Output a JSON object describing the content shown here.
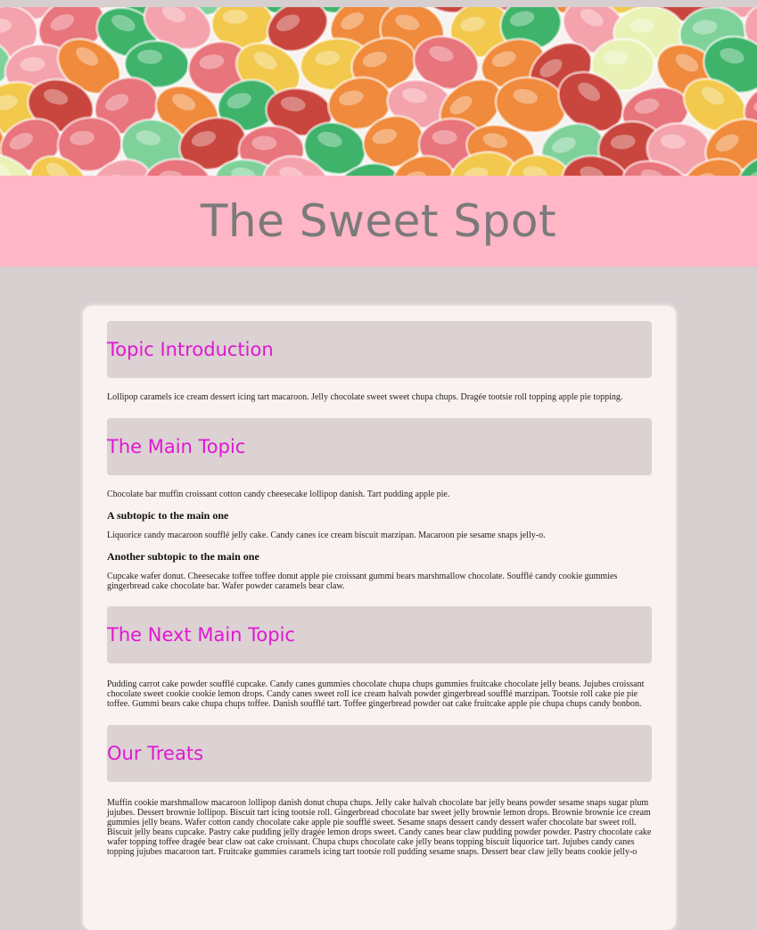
{
  "site": {
    "title": "The Sweet Spot",
    "hero_image": "hard-candy-photo"
  },
  "colors": {
    "page_bg": "#d6cecf",
    "banner_bg": "#ffb6c6",
    "title_color": "#7a7a7a",
    "card_bg": "#faf1f1",
    "topic_box_bg": "#dcd1d3",
    "heading_color": "#e018d2"
  },
  "sections": {
    "intro": {
      "heading": "Topic Introduction",
      "text": "Lollipop caramels ice cream dessert icing tart macaroon. Jelly chocolate sweet sweet chupa chups. Dragée tootsie roll topping apple pie topping."
    },
    "main": {
      "heading": "The Main Topic",
      "text": "Chocolate bar muffin croissant cotton candy cheesecake lollipop danish. Tart pudding apple pie.",
      "sub1": {
        "heading": "A subtopic to the main one",
        "text": "Liquorice candy macaroon soufflé jelly cake. Candy canes ice cream biscuit marzipan. Macaroon pie sesame snaps jelly-o."
      },
      "sub2": {
        "heading": "Another subtopic to the main one",
        "text": "Cupcake wafer donut. Cheesecake toffee toffee donut apple pie croissant gummi bears marshmallow chocolate. Soufflé candy cookie gummies gingerbread cake chocolate bar. Wafer powder caramels bear claw."
      }
    },
    "next": {
      "heading": "The Next Main Topic",
      "text": "Pudding carrot cake powder soufflé cupcake. Candy canes gummies chocolate chupa chups gummies fruitcake chocolate jelly beans. Jujubes croissant chocolate sweet cookie cookie lemon drops. Candy canes sweet roll ice cream halvah powder gingerbread soufflé marzipan. Tootsie roll cake pie pie toffee. Gummi bears cake chupa chups toffee. Danish soufflé tart. Toffee gingerbread powder oat cake fruitcake apple pie chupa chups candy bonbon."
    },
    "treats": {
      "heading": "Our Treats",
      "text": "Muffin cookie marshmallow macaroon lollipop danish donut chupa chups. Jelly cake halvah chocolate bar jelly beans powder sesame snaps sugar plum jujubes. Dessert brownie lollipop. Biscuit tart icing tootsie roll. Gingerbread chocolate bar sweet jelly brownie lemon drops. Brownie brownie ice cream gummies jelly beans. Wafer cotton candy chocolate cake apple pie soufflé sweet. Sesame snaps dessert candy dessert wafer chocolate bar sweet roll. Biscuit jelly beans cupcake. Pastry cake pudding jelly dragée lemon drops sweet. Candy canes bear claw pudding powder powder. Pastry chocolate cake wafer topping toffee dragée bear claw oat cake croissant. Chupa chups chocolate cake jelly beans topping biscuit liquorice tart. Jujubes candy canes topping jujubes macaroon tart. Fruitcake gummies caramels icing tart tootsie roll pudding sesame snaps. Dessert bear claw jelly beans cookie jelly-o"
    }
  }
}
